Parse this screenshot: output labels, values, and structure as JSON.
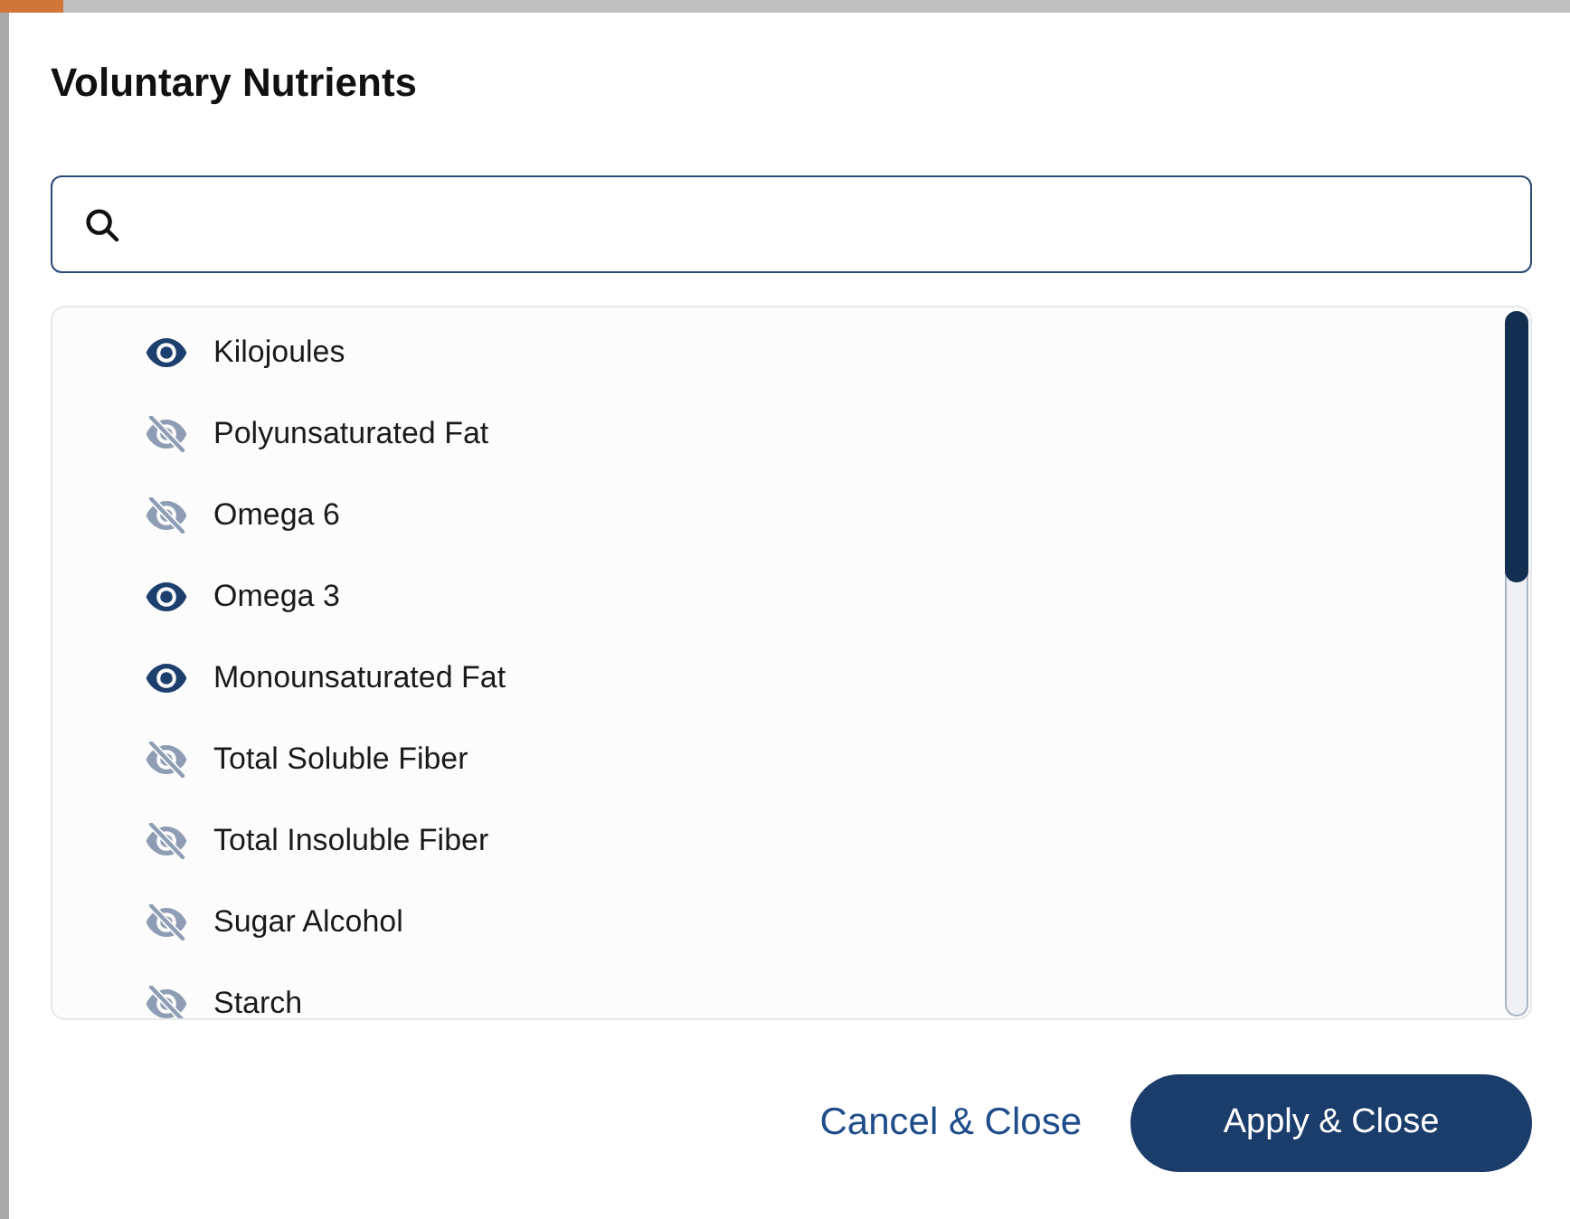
{
  "dialog": {
    "title": "Voluntary Nutrients"
  },
  "nutrients": [
    {
      "label": "Kilojoules",
      "visible": true
    },
    {
      "label": "Polyunsaturated Fat",
      "visible": false
    },
    {
      "label": "Omega 6",
      "visible": false
    },
    {
      "label": "Omega 3",
      "visible": true
    },
    {
      "label": "Monounsaturated Fat",
      "visible": true
    },
    {
      "label": "Total Soluble Fiber",
      "visible": false
    },
    {
      "label": "Total Insoluble Fiber",
      "visible": false
    },
    {
      "label": "Sugar Alcohol",
      "visible": false
    },
    {
      "label": "Starch",
      "visible": false
    }
  ],
  "footer": {
    "cancel_button": "Cancel & Close",
    "apply_button": "Apply & Close"
  }
}
